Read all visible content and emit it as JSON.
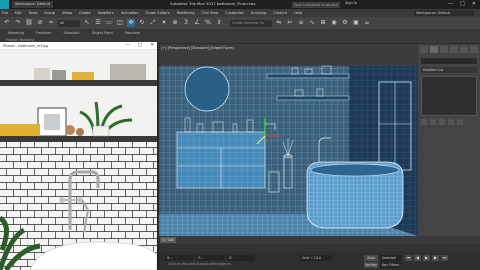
{
  "window": {
    "title": "Autodesk 3ds Max 2017    bathroom_Final.max",
    "tab_label": "Workspace: Default",
    "search_placeholder": "Type a keyword or phrase",
    "signin_label": "Sign In",
    "controls": [
      "—",
      "□",
      "✕"
    ]
  },
  "menu": {
    "items": [
      "File",
      "Edit",
      "Tools",
      "Group",
      "Views",
      "Create",
      "Modifiers",
      "Animation",
      "Graph Editors",
      "Rendering",
      "Civil View",
      "Customize",
      "Scripting",
      "Content",
      "Help"
    ],
    "workspace_label": "Workspaces: Default"
  },
  "toolbar": {
    "selection_filter": "All",
    "create_selection_set": "Create Selection Se",
    "icons": [
      "undo-icon",
      "redo-icon",
      "link-icon",
      "unlink-icon",
      "bind-icon",
      "select-icon",
      "select-by-name-icon",
      "rect-select-icon",
      "window-crossing-icon",
      "move-icon",
      "rotate-icon",
      "scale-icon",
      "view-icon",
      "pivot-icon",
      "snap-icon",
      "angle-snap-icon",
      "percent-snap-icon",
      "spinner-snap-icon",
      "edit-named-sel-icon",
      "mirror-icon",
      "align-icon",
      "layer-icon",
      "curve-editor-icon",
      "schematic-icon",
      "material-editor-icon",
      "render-setup-icon",
      "render-frame-icon",
      "render-icon"
    ]
  },
  "ribbon": {
    "tabs": [
      "Modeling",
      "Freeform",
      "Selection",
      "Object Paint",
      "Populate"
    ],
    "sub_label": "Polygon Modeling"
  },
  "viewport": {
    "label": "[+] [Perspective] [Standard] [Edged Faces]"
  },
  "cmdpanel": {
    "modifier_list": "Modifier List"
  },
  "timeline": {
    "frame_label": "0 / 100"
  },
  "status": {
    "x_label": "X: -",
    "y_label": "Y: -",
    "z_label": "Z: -",
    "grid_label": "Grid = 10.0",
    "message": "Click or click-and-drag to select objects",
    "autokey": "Auto Key",
    "selected": "Selected",
    "setkey": "Set Key",
    "key_filters": "Key Filters..."
  },
  "photo_window": {
    "title": "Photos - bathroom_ref.jpg",
    "controls": [
      "—",
      "□",
      "✕"
    ]
  },
  "colors": {
    "accent": "#1a9bb0",
    "wire": "#cfe9ff",
    "viewport_bg": "#3c3c3c",
    "scene_blue": "#2a6f9e"
  }
}
